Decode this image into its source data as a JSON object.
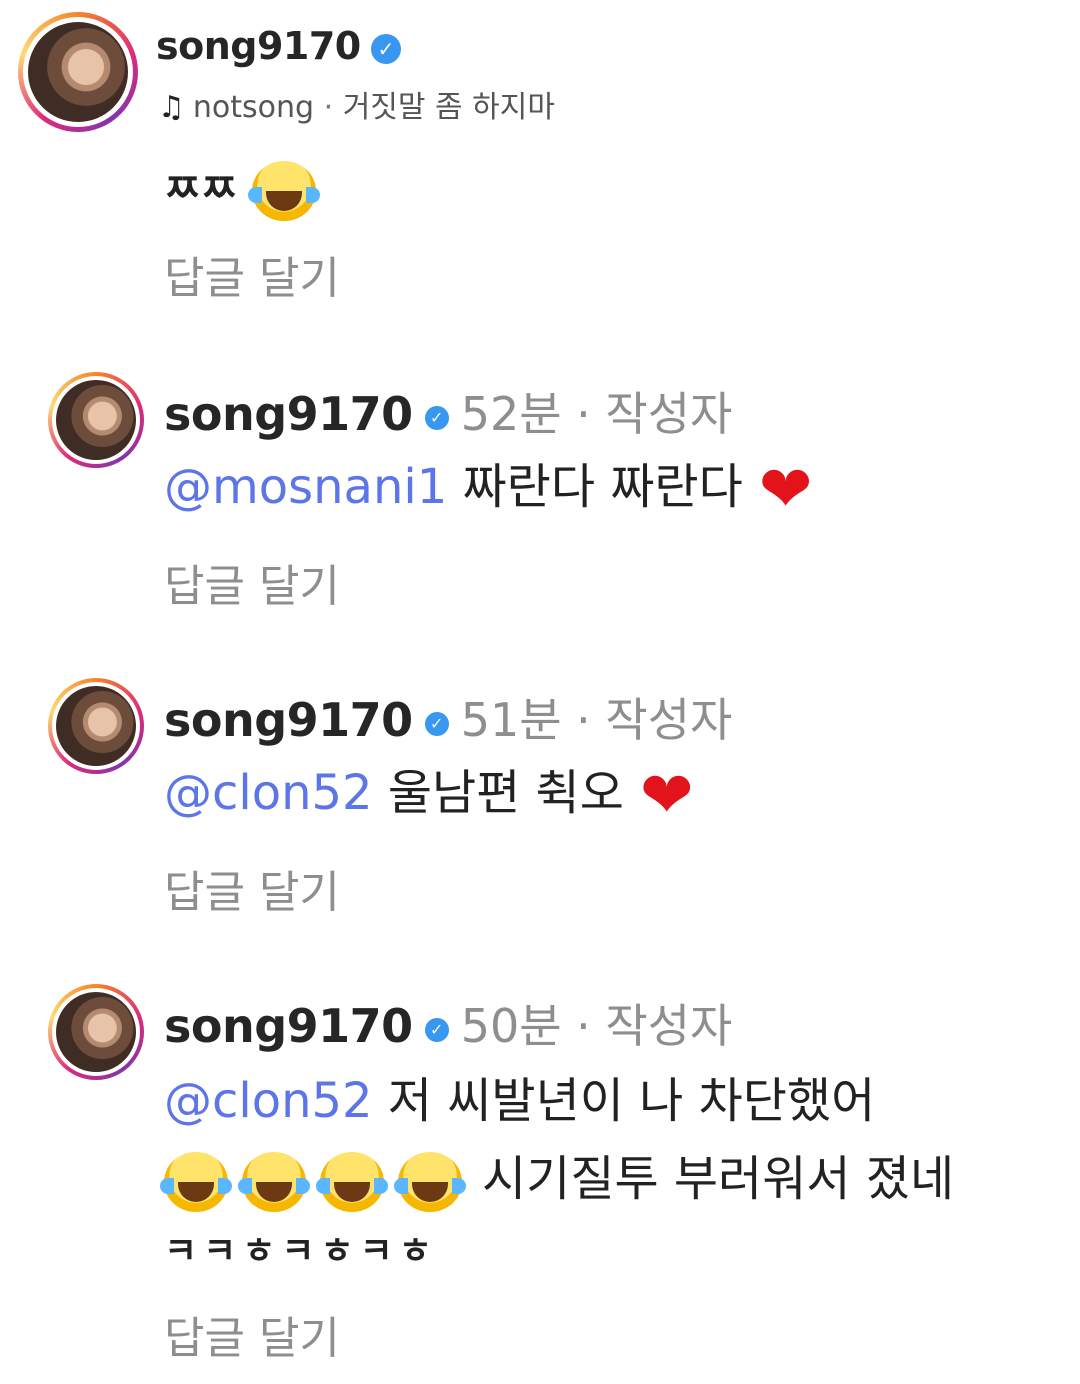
{
  "header": {
    "username": "song9170",
    "verified_icon": "✓",
    "music_icon": "♫",
    "music_artist": "notsong",
    "separator": " · ",
    "music_title": "거짓말 좀 하지마"
  },
  "top_comment": {
    "text": "ㅉㅉ",
    "reply_label": "답글 달기"
  },
  "comments": [
    {
      "username": "song9170",
      "verified_icon": "✓",
      "time": "52분",
      "separator": " · ",
      "role": "작성자",
      "mention": "@mosnani1",
      "text": " 짜란다 짜란다",
      "heart": "❤",
      "reply_label": "답글 달기"
    },
    {
      "username": "song9170",
      "verified_icon": "✓",
      "time": "51분",
      "separator": " · ",
      "role": "작성자",
      "mention": "@clon52",
      "text": " 울남편 췩오",
      "heart": "❤",
      "reply_label": "답글 달기"
    },
    {
      "username": "song9170",
      "verified_icon": "✓",
      "time": "50분",
      "separator": " · ",
      "role": "작성자",
      "mention": "@clon52",
      "text": " 저 씨발년이 나 차단했어",
      "line2": "시기질투 부러워서 졌네",
      "line3": "ㅋㅋㅎㅋㅎㅋㅎ",
      "reply_label": "답글 달기"
    }
  ]
}
